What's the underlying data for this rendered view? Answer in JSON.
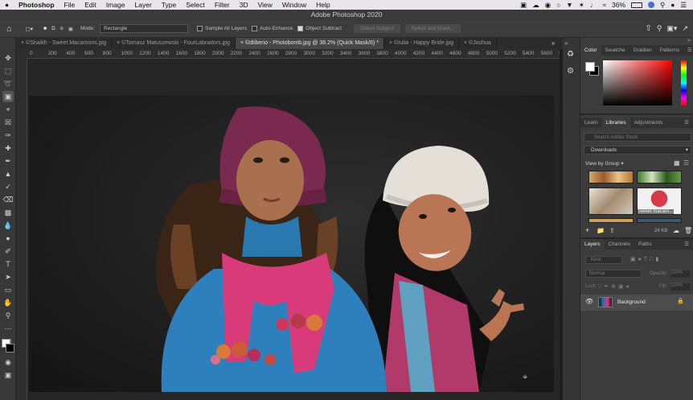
{
  "menubar": {
    "apple": "",
    "app": "Photoshop",
    "items": [
      "File",
      "Edit",
      "Image",
      "Layer",
      "Type",
      "Select",
      "Filter",
      "3D",
      "View",
      "Window",
      "Help"
    ],
    "battery": "36%"
  },
  "window": {
    "title": "Adobe Photoshop 2020"
  },
  "options": {
    "mode_label": "Mode:",
    "mode_value": "Rectangle",
    "sample_all_layers": "Sample All Layers",
    "auto_enhance": "Auto-Enhance",
    "object_subtract": "Object Subtract",
    "select_subject": "Select Subject",
    "select_and_mask": "Select and Mask..."
  },
  "tabs": [
    "©Shaikh - Sweet Macaroons.jpg",
    "©Tomasz Matuszewski - FourLabradors.jpg",
    "©dtiberio - Photobomb.jpg @ 36.2% (Quick Mask/8) *",
    "©Iulia - Happy Bride.jpg",
    "©Joshua"
  ],
  "ruler": {
    "ticks": [
      "0",
      "200",
      "400",
      "600",
      "800",
      "1000",
      "1200",
      "1400",
      "1600",
      "1800",
      "2000",
      "2200",
      "2400",
      "2600",
      "2800",
      "3000",
      "3200",
      "3400",
      "3600",
      "3800",
      "4000",
      "4200",
      "4400",
      "4600",
      "4800",
      "5000",
      "5200",
      "5400",
      "5600",
      "5800"
    ]
  },
  "color_panel": {
    "tabs": [
      "Color",
      "Swatche",
      "Gradien",
      "Patterns"
    ],
    "fg": "#ffffff",
    "bg": "#000000"
  },
  "libraries_panel": {
    "tabs": [
      "Learn",
      "Libraries",
      "Adjustments"
    ],
    "search_placeholder": "Search Adobe Stock",
    "library": "Downloads",
    "view_by": "View by Group",
    "item_label": "Sweet macaro...",
    "size": "24 KB"
  },
  "layers_panel": {
    "tabs": [
      "Layers",
      "Channels",
      "Paths"
    ],
    "kind": "Kind",
    "blend": "Normal",
    "opacity_label": "Opacity:",
    "opacity": "100%",
    "lock_label": "Lock:",
    "fill_label": "Fill:",
    "fill": "100%",
    "layer_name": "Background"
  }
}
